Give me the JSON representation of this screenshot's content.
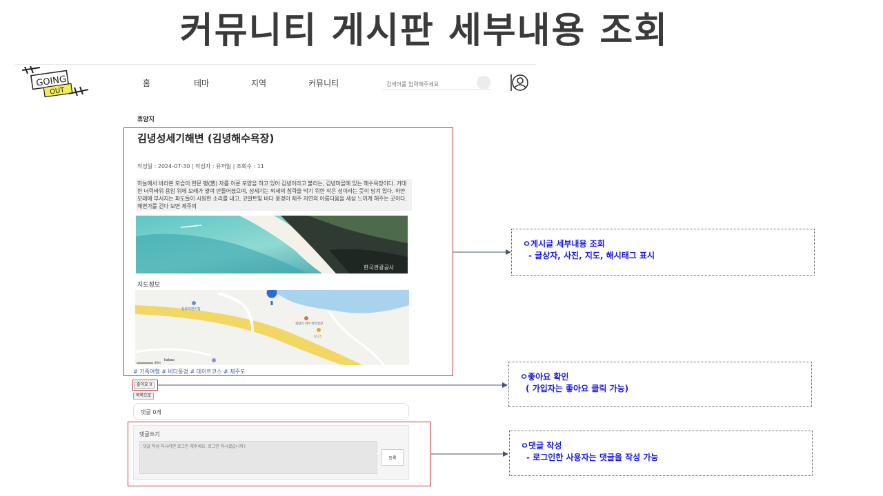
{
  "slide": {
    "title": "커뮤니티 게시판 세부내용 조회"
  },
  "header": {
    "logo_line1": "GOING",
    "logo_line2": "OUT",
    "nav": [
      "홈",
      "테마",
      "지역",
      "커뮤니티"
    ],
    "search_placeholder": "검색어를 입력해주세요"
  },
  "post": {
    "category": "휴양지",
    "title": "김녕성세기해변 (김녕해수욕장)",
    "meta": "작성일 : 2024-07-30 | 작성자 : 유저일 | 조회수 : 11",
    "body": "하늘에서 바라본 모습이 한문 팽(䒱) 자를 이룬 모양을 하고 있어 김녕이라고 불리는, 김녕마을에 있는 해수욕장이다. 거대한 너럭바위 용암 위에 모래가 쌓여 만들어졌으며, 성세기는 외세의 침략을 막기 위한 작은 성이라는 뜻이 담겨 있다. 하얀 모래에 부서지는 파도들이 시원한 소리를 내고, 코발트빛 바다 풍경이 제주 자연의 아름다움을 새삼 느끼게 해주는 곳이다. 해변가를 걷다 보면 제주의",
    "photo_watermark": "한국관광공사",
    "map_label": "지도정보",
    "map_places": [
      "산유이전이집",
      "김녕리 서부 마트방장",
      "6525"
    ],
    "map_scale": "80m",
    "map_brand": "kakao",
    "hashtags": "# 가족여행 # 바다풍경 # 데이트코스 # 제주도",
    "like_label": "좋아요 0",
    "list_label": "목록으로"
  },
  "comments": {
    "count_label": "댓글 0개",
    "write_label": "댓글쓰기",
    "placeholder": "댓글 작성 하시려면 로그인 해주세요. 로그인 하시겠습니까?",
    "submit_label": "등록"
  },
  "annotations": [
    {
      "title": "ㅇ게시글 세부내용 조회",
      "sub": "- 글상자, 사진, 지도, 해시태그 표시"
    },
    {
      "title": "ㅇ좋아요 확인",
      "sub": "( 가입자는 좋아요 클릭 가능)"
    },
    {
      "title": "ㅇ댓글 작성",
      "sub": "- 로그인한 사용자는 댓글을 작성 가능"
    }
  ],
  "colors": {
    "highlight_box": "#c8343a",
    "annotation_text": "#1a1adc",
    "hashtag": "#3b5ea8"
  }
}
